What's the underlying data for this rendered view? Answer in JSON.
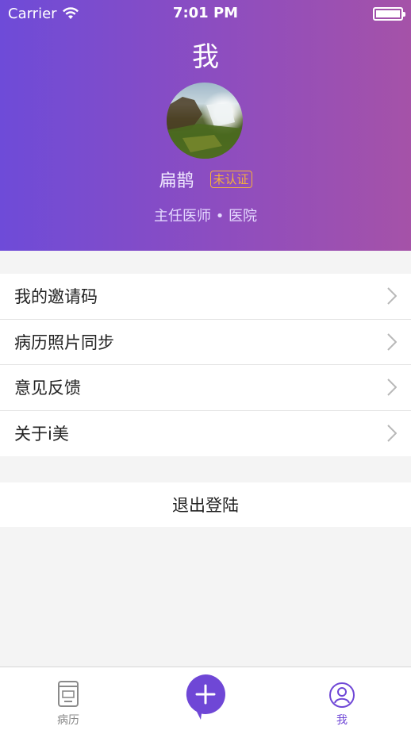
{
  "status_bar": {
    "carrier": "Carrier",
    "time": "7:01 PM"
  },
  "header": {
    "title": "我",
    "doctor_name": "扁鹊",
    "verify_badge": "未认证",
    "subtitle": "主任医师 • 医院"
  },
  "menu": {
    "items": [
      {
        "label": "我的邀请码"
      },
      {
        "label": "病历照片同步"
      },
      {
        "label": "意见反馈"
      },
      {
        "label": "关于i美"
      }
    ]
  },
  "logout_label": "退出登陆",
  "tabbar": {
    "records_label": "病历",
    "me_label": "我"
  },
  "colors": {
    "accent": "#6f47d6",
    "badge": "#f6b13a"
  }
}
